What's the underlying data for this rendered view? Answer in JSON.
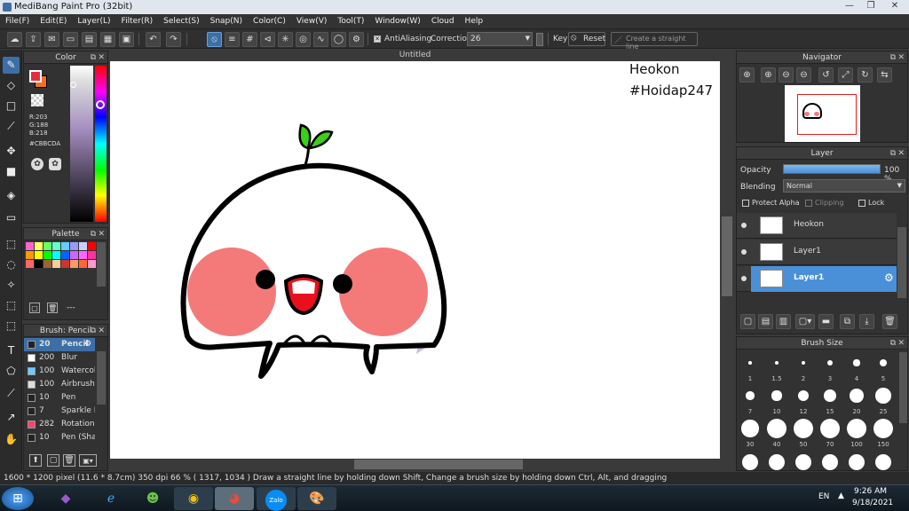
{
  "window": {
    "title": "MediBang Paint Pro (32bit)"
  },
  "menu": [
    "File(F)",
    "Edit(E)",
    "Layer(L)",
    "Filter(R)",
    "Select(S)",
    "Snap(N)",
    "Color(C)",
    "View(V)",
    "Tool(T)",
    "Window(W)",
    "Cloud",
    "Help"
  ],
  "toolbar": {
    "antialiasing_label": "AntiAliasing",
    "correction_label": "Correction",
    "correction_value": "26",
    "key_label": "Key",
    "reset_label": "Reset",
    "straight_line_label": "Create a straight line"
  },
  "color_panel": {
    "title": "Color",
    "r": "R:203",
    "g": "G:188",
    "b": "B:218",
    "hex": "#CBBCDA",
    "primary_color": "#e03040",
    "secondary_color": "#f07020"
  },
  "palette_panel": {
    "title": "Palette",
    "more_label": "---",
    "swatches": [
      "#ff66cc",
      "#ffff66",
      "#66ff66",
      "#66ffcc",
      "#66ccff",
      "#9999ff",
      "#ccccff",
      "#ff0000",
      "#ff9900",
      "#ffff00",
      "#00ff00",
      "#00ffff",
      "#0066ff",
      "#cc66ff",
      "#ff66ff",
      "#ff3399",
      "#ff6666",
      "#000000",
      "#996633",
      "#ffcc99",
      "#cc3333",
      "#ff9966",
      "#ff6633",
      "#ff99cc"
    ]
  },
  "brush_panel": {
    "title": "Brush: Pencil",
    "items": [
      {
        "size": "20",
        "name": "Pencil",
        "color": "#222222"
      },
      {
        "size": "200",
        "name": "Blur",
        "color": "#ffffff"
      },
      {
        "size": "100",
        "name": "Watercol",
        "color": "#66ccff"
      },
      {
        "size": "100",
        "name": "Airbrush",
        "color": "#dddddd"
      },
      {
        "size": "10",
        "name": "Pen",
        "color": "#222222"
      },
      {
        "size": "7",
        "name": "Sparkle B",
        "color": "#222222"
      },
      {
        "size": "282",
        "name": "Rotation",
        "color": "#ff4466"
      },
      {
        "size": "10",
        "name": "Pen (Sha",
        "color": "#222222"
      }
    ]
  },
  "document": {
    "tab_title": "Untitled",
    "text_line1": "Heokon",
    "text_line2": "#Hoidap247"
  },
  "navigator_panel": {
    "title": "Navigator"
  },
  "layer_panel": {
    "title": "Layer",
    "opacity_label": "Opacity",
    "opacity_value": "100 %",
    "opacity_level": 1.0,
    "blending_label": "Blending",
    "blending_value": "Normal",
    "protect_alpha": "Protect Alpha",
    "clipping": "Clipping",
    "lock": "Lock",
    "layers": [
      {
        "name": "Heokon",
        "selected": false
      },
      {
        "name": "Layer1",
        "selected": false
      },
      {
        "name": "Layer1",
        "selected": true
      }
    ]
  },
  "brush_size_panel": {
    "title": "Brush Size",
    "sizes": [
      "1",
      "1.5",
      "2",
      "3",
      "4",
      "5",
      "7",
      "10",
      "12",
      "15",
      "20",
      "25",
      "30",
      "40",
      "50",
      "70",
      "100",
      "150"
    ]
  },
  "status": {
    "text": "1600 * 1200 pixel   (11.6 * 8.7cm)   350 dpi   66 %   ( 1317, 1034 )   Draw a straight line by holding down Shift, Change a brush size by holding down Ctrl, Alt, and dragging"
  },
  "taskbar": {
    "lang": "EN",
    "time": "9:26 AM",
    "date": "9/18/2021",
    "zalo_label": "Zalo"
  },
  "colors": {
    "accent": "#3d6fa6",
    "selected_layer": "#4a90d9"
  }
}
